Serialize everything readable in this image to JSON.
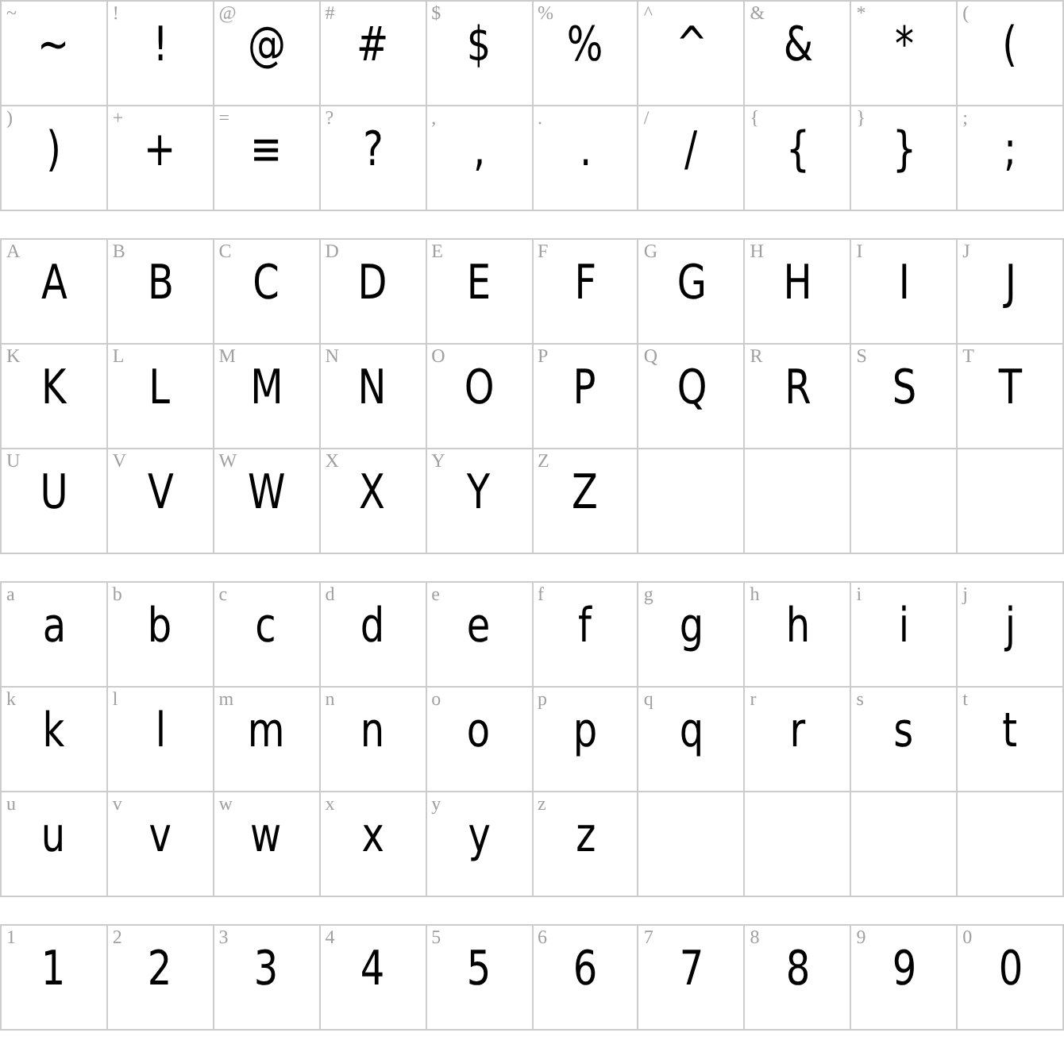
{
  "sections": [
    {
      "cells": [
        {
          "label": "~",
          "glyph": "~"
        },
        {
          "label": "!",
          "glyph": "!"
        },
        {
          "label": "@",
          "glyph": "@"
        },
        {
          "label": "#",
          "glyph": "#"
        },
        {
          "label": "$",
          "glyph": "$"
        },
        {
          "label": "%",
          "glyph": "%"
        },
        {
          "label": "^",
          "glyph": "^"
        },
        {
          "label": "&",
          "glyph": "&"
        },
        {
          "label": "*",
          "glyph": "*"
        },
        {
          "label": "(",
          "glyph": "("
        },
        {
          "label": ")",
          "glyph": ")"
        },
        {
          "label": "+",
          "glyph": "+"
        },
        {
          "label": "=",
          "glyph": "≡"
        },
        {
          "label": "?",
          "glyph": "?"
        },
        {
          "label": ",",
          "glyph": ","
        },
        {
          "label": ".",
          "glyph": "."
        },
        {
          "label": "/",
          "glyph": "/"
        },
        {
          "label": "{",
          "glyph": "{"
        },
        {
          "label": "}",
          "glyph": "}"
        },
        {
          "label": ";",
          "glyph": ";"
        }
      ]
    },
    {
      "cells": [
        {
          "label": "A",
          "glyph": "A"
        },
        {
          "label": "B",
          "glyph": "B"
        },
        {
          "label": "C",
          "glyph": "C"
        },
        {
          "label": "D",
          "glyph": "D"
        },
        {
          "label": "E",
          "glyph": "E"
        },
        {
          "label": "F",
          "glyph": "F"
        },
        {
          "label": "G",
          "glyph": "G"
        },
        {
          "label": "H",
          "glyph": "H"
        },
        {
          "label": "I",
          "glyph": "I"
        },
        {
          "label": "J",
          "glyph": "J"
        },
        {
          "label": "K",
          "glyph": "K"
        },
        {
          "label": "L",
          "glyph": "L"
        },
        {
          "label": "M",
          "glyph": "M"
        },
        {
          "label": "N",
          "glyph": "N"
        },
        {
          "label": "O",
          "glyph": "O"
        },
        {
          "label": "P",
          "glyph": "P"
        },
        {
          "label": "Q",
          "glyph": "Q"
        },
        {
          "label": "R",
          "glyph": "R"
        },
        {
          "label": "S",
          "glyph": "S"
        },
        {
          "label": "T",
          "glyph": "T"
        },
        {
          "label": "U",
          "glyph": "U"
        },
        {
          "label": "V",
          "glyph": "V"
        },
        {
          "label": "W",
          "glyph": "W"
        },
        {
          "label": "X",
          "glyph": "X"
        },
        {
          "label": "Y",
          "glyph": "Y"
        },
        {
          "label": "Z",
          "glyph": "Z"
        }
      ]
    },
    {
      "cells": [
        {
          "label": "a",
          "glyph": "a"
        },
        {
          "label": "b",
          "glyph": "b"
        },
        {
          "label": "c",
          "glyph": "c"
        },
        {
          "label": "d",
          "glyph": "d"
        },
        {
          "label": "e",
          "glyph": "e"
        },
        {
          "label": "f",
          "glyph": "f"
        },
        {
          "label": "g",
          "glyph": "g"
        },
        {
          "label": "h",
          "glyph": "h"
        },
        {
          "label": "i",
          "glyph": "i"
        },
        {
          "label": "j",
          "glyph": "j"
        },
        {
          "label": "k",
          "glyph": "k"
        },
        {
          "label": "l",
          "glyph": "l"
        },
        {
          "label": "m",
          "glyph": "m"
        },
        {
          "label": "n",
          "glyph": "n"
        },
        {
          "label": "o",
          "glyph": "o"
        },
        {
          "label": "p",
          "glyph": "p"
        },
        {
          "label": "q",
          "glyph": "q"
        },
        {
          "label": "r",
          "glyph": "r"
        },
        {
          "label": "s",
          "glyph": "s"
        },
        {
          "label": "t",
          "glyph": "t"
        },
        {
          "label": "u",
          "glyph": "u"
        },
        {
          "label": "v",
          "glyph": "v"
        },
        {
          "label": "w",
          "glyph": "w"
        },
        {
          "label": "x",
          "glyph": "x"
        },
        {
          "label": "y",
          "glyph": "y"
        },
        {
          "label": "z",
          "glyph": "z"
        }
      ]
    },
    {
      "cells": [
        {
          "label": "1",
          "glyph": "1"
        },
        {
          "label": "2",
          "glyph": "2"
        },
        {
          "label": "3",
          "glyph": "3"
        },
        {
          "label": "4",
          "glyph": "4"
        },
        {
          "label": "5",
          "glyph": "5"
        },
        {
          "label": "6",
          "glyph": "6"
        },
        {
          "label": "7",
          "glyph": "7"
        },
        {
          "label": "8",
          "glyph": "8"
        },
        {
          "label": "9",
          "glyph": "9"
        },
        {
          "label": "0",
          "glyph": "0"
        }
      ]
    }
  ]
}
